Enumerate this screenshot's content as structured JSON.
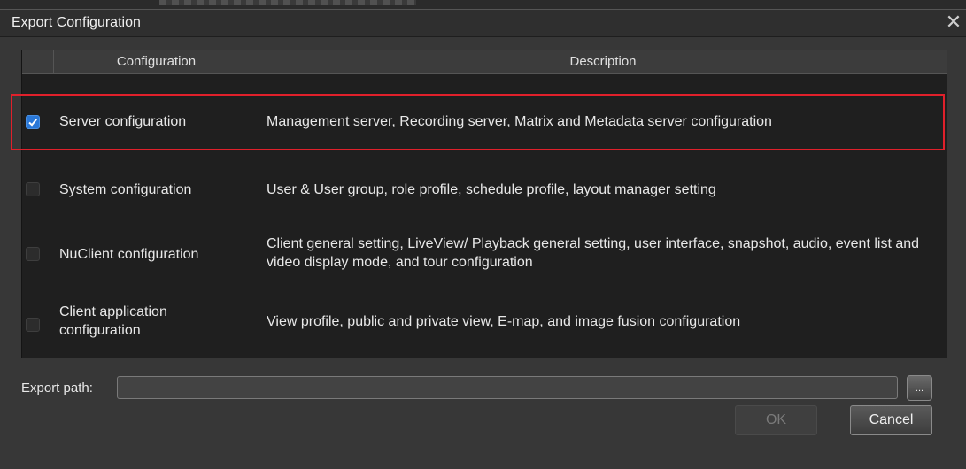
{
  "window": {
    "title": "Export Configuration",
    "close_symbol": "✕"
  },
  "table": {
    "headers": [
      "Configuration",
      "Description"
    ],
    "rows": [
      {
        "checked": true,
        "config": "Server configuration",
        "description": "Management server, Recording server, Matrix and Metadata server configuration"
      },
      {
        "checked": false,
        "config": "System configuration",
        "description": "User & User group, role profile, schedule profile, layout manager setting"
      },
      {
        "checked": false,
        "config": "NuClient configuration",
        "description": "Client general setting, LiveView/ Playback general setting, user interface, snapshot, audio, event list and video display mode, and tour configuration"
      },
      {
        "checked": false,
        "config": "Client application configuration",
        "description": "View profile, public and private view, E-map, and image fusion configuration"
      }
    ]
  },
  "export_path": {
    "label": "Export path:",
    "value": "",
    "browse_label": "..."
  },
  "buttons": {
    "ok": "OK",
    "cancel": "Cancel"
  },
  "colors": {
    "highlight_box": "#e0202b",
    "checkbox_checked": "#2a78d8"
  }
}
